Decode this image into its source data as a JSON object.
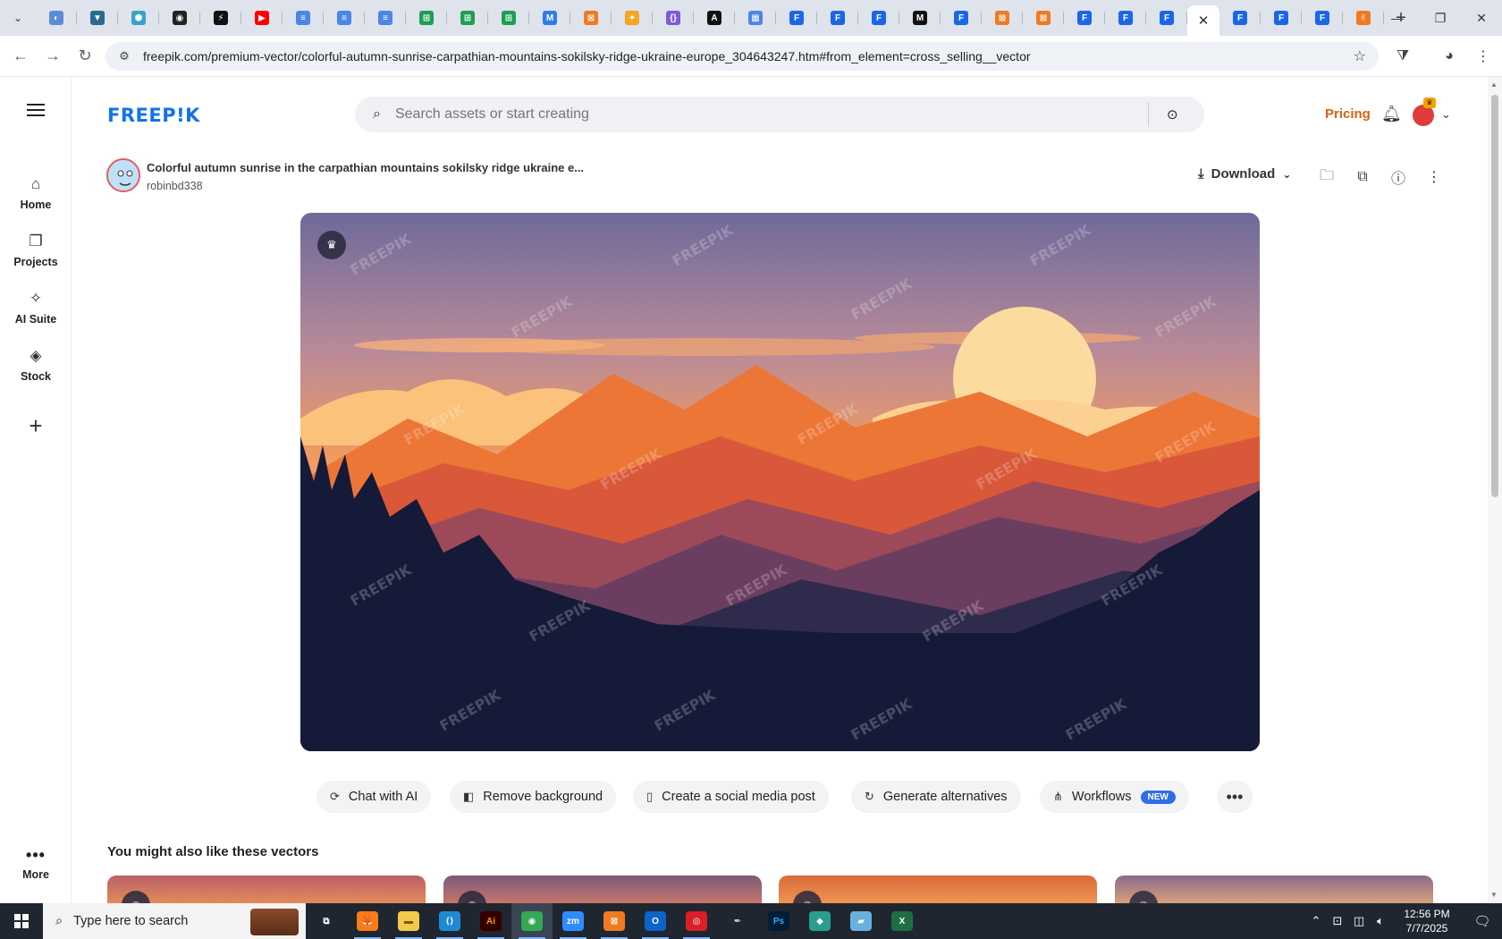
{
  "browser": {
    "tab_favicons": [
      {
        "name": "tab-favicon-1",
        "color": "#5b8dd6",
        "glyph": "◐"
      },
      {
        "name": "tab-favicon-2",
        "color": "#2b6a8f",
        "glyph": "▼"
      },
      {
        "name": "tab-favicon-3",
        "color": "#3aa3c4",
        "glyph": "⬢"
      },
      {
        "name": "tab-favicon-4",
        "color": "#222222",
        "glyph": "◉"
      },
      {
        "name": "tab-favicon-5",
        "color": "#111111",
        "glyph": "⚡"
      },
      {
        "name": "tab-favicon-6",
        "color": "#ff0000",
        "glyph": "▶"
      },
      {
        "name": "tab-favicon-7",
        "color": "#4a86e8",
        "glyph": "≡"
      },
      {
        "name": "tab-favicon-8",
        "color": "#4a86e8",
        "glyph": "≡"
      },
      {
        "name": "tab-favicon-9",
        "color": "#4a86e8",
        "glyph": "≡"
      },
      {
        "name": "tab-favicon-10",
        "color": "#1e9e54",
        "glyph": "⊞"
      },
      {
        "name": "tab-favicon-11",
        "color": "#1e9e54",
        "glyph": "⊞"
      },
      {
        "name": "tab-favicon-12",
        "color": "#1e9e54",
        "glyph": "⊞"
      },
      {
        "name": "tab-favicon-13",
        "color": "#2b7de9",
        "glyph": "M"
      },
      {
        "name": "tab-favicon-14",
        "color": "#f07a22",
        "glyph": "⊠"
      },
      {
        "name": "tab-favicon-15",
        "color": "#f5a623",
        "glyph": "✦"
      },
      {
        "name": "tab-favicon-16",
        "color": "#7b5bd6",
        "glyph": "{}"
      },
      {
        "name": "tab-favicon-17",
        "color": "#111111",
        "glyph": "A"
      },
      {
        "name": "tab-favicon-18",
        "color": "#4a86e8",
        "glyph": "▦"
      },
      {
        "name": "tab-favicon-19",
        "color": "#1a66e8",
        "glyph": "F"
      },
      {
        "name": "tab-favicon-20",
        "color": "#1a66e8",
        "glyph": "F"
      },
      {
        "name": "tab-favicon-21",
        "color": "#1a66e8",
        "glyph": "F"
      },
      {
        "name": "tab-favicon-22",
        "color": "#111111",
        "glyph": "M"
      },
      {
        "name": "tab-favicon-23",
        "color": "#1a66e8",
        "glyph": "F"
      },
      {
        "name": "tab-favicon-24",
        "color": "#f07a22",
        "glyph": "⊠"
      },
      {
        "name": "tab-favicon-25",
        "color": "#f07a22",
        "glyph": "⊠"
      },
      {
        "name": "tab-favicon-26",
        "color": "#1a66e8",
        "glyph": "F"
      },
      {
        "name": "tab-favicon-27",
        "color": "#1a66e8",
        "glyph": "F"
      },
      {
        "name": "tab-favicon-28",
        "color": "#1a66e8",
        "glyph": "F"
      }
    ],
    "tab_favicons_after": [
      {
        "name": "tab-favicon-29",
        "color": "#1a66e8",
        "glyph": "F"
      },
      {
        "name": "tab-favicon-30",
        "color": "#1a66e8",
        "glyph": "F"
      },
      {
        "name": "tab-favicon-31",
        "color": "#1a66e8",
        "glyph": "F"
      },
      {
        "name": "tab-favicon-32",
        "color": "#f07a22",
        "glyph": "✌"
      }
    ],
    "active_tab_close": "✕",
    "new_tab": "+",
    "url": "freepik.com/premium-vector/colorful-autumn-sunrise-carpathian-mountains-sokilsky-ridge-ukraine-europe_304643247.htm#from_element=cross_selling__vector",
    "accent_color": "#1273eb"
  },
  "sidebar": {
    "items": [
      {
        "label": "Home",
        "icon": "home-icon",
        "glyph": "⌂"
      },
      {
        "label": "Projects",
        "icon": "projects-icon",
        "glyph": "❐"
      },
      {
        "label": "AI Suite",
        "icon": "sparkles-icon",
        "glyph": "✧"
      },
      {
        "label": "Stock",
        "icon": "shapes-icon",
        "glyph": "◈"
      }
    ],
    "more_label": "More"
  },
  "header": {
    "logo": "FREEP!K",
    "search_placeholder": "Search assets or start creating",
    "pricing_label": "Pricing",
    "pricing_color": "#d9620f"
  },
  "asset": {
    "title": "Colorful autumn sunrise in the carpathian mountains sokilsky ridge ukraine e...",
    "author": "robinbd338",
    "download_label": "Download",
    "watermark": "FREEPIK"
  },
  "actions": {
    "pills": [
      {
        "label": "Chat with AI",
        "icon": "chat-ai-icon",
        "glyph": "⟳"
      },
      {
        "label": "Remove background",
        "icon": "remove-bg-icon",
        "glyph": "◧"
      },
      {
        "label": "Create a social media post",
        "icon": "phone-icon",
        "glyph": "▯"
      },
      {
        "label": "Generate alternatives",
        "icon": "refresh-icon",
        "glyph": "↻"
      },
      {
        "label": "Workflows",
        "icon": "workflow-icon",
        "glyph": "⋔",
        "badge": "NEW"
      }
    ]
  },
  "related": {
    "title": "You might also like these vectors"
  },
  "taskbar": {
    "search_placeholder": "Type here to search",
    "apps": [
      {
        "name": "task-view",
        "label": "⧉",
        "bg": "transparent",
        "color": "#fff"
      },
      {
        "name": "firefox",
        "label": "🦊",
        "bg": "#ff7a1a",
        "color": "#fff"
      },
      {
        "name": "file-explorer",
        "label": "▬",
        "bg": "#f2c94c",
        "color": "#7a5b00"
      },
      {
        "name": "vscode",
        "label": "⟨⟩",
        "bg": "#1f8ad2",
        "color": "#fff"
      },
      {
        "name": "illustrator",
        "label": "Ai",
        "bg": "#330000",
        "color": "#ff9a00"
      },
      {
        "name": "chrome",
        "label": "◉",
        "bg": "#34a853",
        "color": "#fff"
      },
      {
        "name": "zoom",
        "label": "zm",
        "bg": "#2d8cff",
        "color": "#fff"
      },
      {
        "name": "xampp",
        "label": "⊠",
        "bg": "#f07a22",
        "color": "#fff"
      },
      {
        "name": "outlook",
        "label": "O",
        "bg": "#0a64c9",
        "color": "#fff"
      },
      {
        "name": "creative-cloud",
        "label": "◎",
        "bg": "#da1f26",
        "color": "#fff"
      },
      {
        "name": "pen-tool",
        "label": "✒",
        "bg": "transparent",
        "color": "#ddd"
      },
      {
        "name": "photoshop",
        "label": "Ps",
        "bg": "#001e36",
        "color": "#31a8ff"
      },
      {
        "name": "app-gem",
        "label": "◆",
        "bg": "#2a9d8f",
        "color": "#fff"
      },
      {
        "name": "app-note",
        "label": "▰",
        "bg": "#6ab0de",
        "color": "#fff"
      },
      {
        "name": "excel",
        "label": "X",
        "bg": "#1d6f42",
        "color": "#fff"
      }
    ],
    "time": "12:56 PM",
    "date": "7/7/2025"
  }
}
